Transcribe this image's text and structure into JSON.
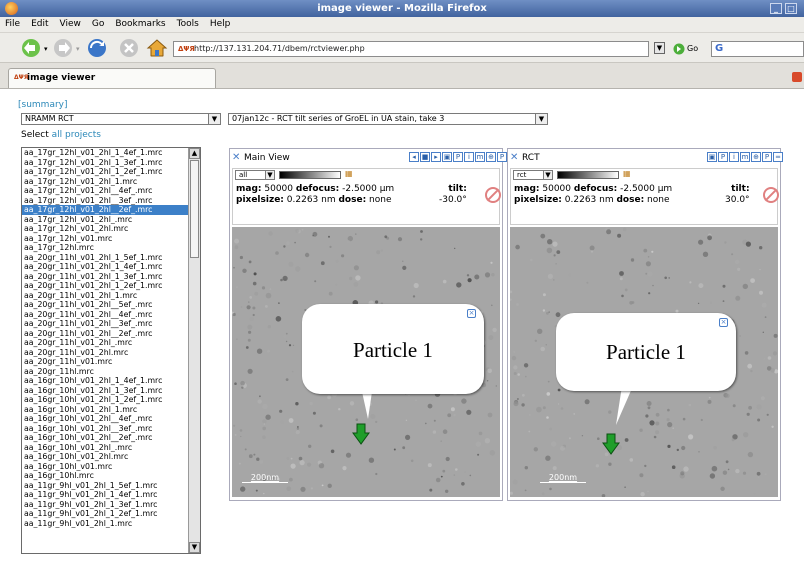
{
  "window": {
    "title": "image viewer - Mozilla Firefox"
  },
  "menu": [
    "File",
    "Edit",
    "View",
    "Go",
    "Bookmarks",
    "Tools",
    "Help"
  ],
  "nav": {
    "url": "http://137.131.204.71/dbem/rctviewer.php",
    "go_label": "Go"
  },
  "tab": {
    "label": "image viewer"
  },
  "page": {
    "summary_link": "[summary]",
    "project_select": "NRAMM RCT",
    "session_select": "07jan12c - RCT tilt series of GroEL in UA stain, take 3",
    "select_label": "Select",
    "all_projects_link": "all projects"
  },
  "files": [
    "aa_17gr_12hl_v01_2hl_1_4ef_1.mrc",
    "aa_17gr_12hl_v01_2hl_1_3ef_1.mrc",
    "aa_17gr_12hl_v01_2hl_1_2ef_1.mrc",
    "aa_17gr_12hl_v01_2hl_1.mrc",
    "aa_17gr_12hl_v01_2hl__4ef_.mrc",
    "aa_17gr_12hl_v01_2hl__3ef_.mrc",
    "aa_17gr_12hl_v01_2hl__2ef_.mrc",
    "aa_17gr_12hl_v01_2hl_.mrc",
    "aa_17gr_12hl_v01_2hl.mrc",
    "aa_17gr_12hl_v01.mrc",
    "aa_17gr_12hl.mrc",
    "aa_20gr_11hl_v01_2hl_1_5ef_1.mrc",
    "aa_20gr_11hl_v01_2hl_1_4ef_1.mrc",
    "aa_20gr_11hl_v01_2hl_1_3ef_1.mrc",
    "aa_20gr_11hl_v01_2hl_1_2ef_1.mrc",
    "aa_20gr_11hl_v01_2hl_1.mrc",
    "aa_20gr_11hl_v01_2hl__5ef_.mrc",
    "aa_20gr_11hl_v01_2hl__4ef_.mrc",
    "aa_20gr_11hl_v01_2hl__3ef_.mrc",
    "aa_20gr_11hl_v01_2hl__2ef_.mrc",
    "aa_20gr_11hl_v01_2hl_.mrc",
    "aa_20gr_11hl_v01_2hl.mrc",
    "aa_20gr_11hl_v01.mrc",
    "aa_20gr_11hl.mrc",
    "aa_16gr_10hl_v01_2hl_1_4ef_1.mrc",
    "aa_16gr_10hl_v01_2hl_1_3ef_1.mrc",
    "aa_16gr_10hl_v01_2hl_1_2ef_1.mrc",
    "aa_16gr_10hl_v01_2hl_1.mrc",
    "aa_16gr_10hl_v01_2hl__4ef_.mrc",
    "aa_16gr_10hl_v01_2hl__3ef_.mrc",
    "aa_16gr_10hl_v01_2hl__2ef_.mrc",
    "aa_16gr_10hl_v01_2hl_.mrc",
    "aa_16gr_10hl_v01_2hl.mrc",
    "aa_16gr_10hl_v01.mrc",
    "aa_16gr_10hl.mrc",
    "aa_11gr_9hl_v01_2hl_1_5ef_1.mrc",
    "aa_11gr_9hl_v01_2hl_1_4ef_1.mrc",
    "aa_11gr_9hl_v01_2hl_1_3ef_1.mrc",
    "aa_11gr_9hl_v01_2hl_1_2ef_1.mrc",
    "aa_11gr_9hl_v01_2hl_1.mrc"
  ],
  "selected_file_index": 6,
  "main_view": {
    "title": "Main View",
    "filter": "all",
    "mag_label": "mag:",
    "mag": "50000",
    "defocus_label": "defocus:",
    "defocus": "-2.5000 µm",
    "pixelsize_label": "pixelsize:",
    "pixelsize": "0.2263 nm",
    "dose_label": "dose:",
    "dose": "none",
    "tilt_label": "tilt:",
    "tilt": "-30.0°",
    "callout": "Particle 1",
    "scalebar": "200nm"
  },
  "rct_view": {
    "title": "RCT",
    "filter": "rct",
    "mag_label": "mag:",
    "mag": "50000",
    "defocus_label": "defocus:",
    "defocus": "-2.5000 µm",
    "pixelsize_label": "pixelsize:",
    "pixelsize": "0.2263 nm",
    "dose_label": "dose:",
    "dose": "none",
    "tilt_label": "tilt:",
    "tilt": "30.0°",
    "callout": "Particle 1",
    "scalebar": "200nm"
  },
  "colors": {
    "link": "#2b88b8",
    "selection": "#3c80c8",
    "marker": "#1f9e2a"
  }
}
